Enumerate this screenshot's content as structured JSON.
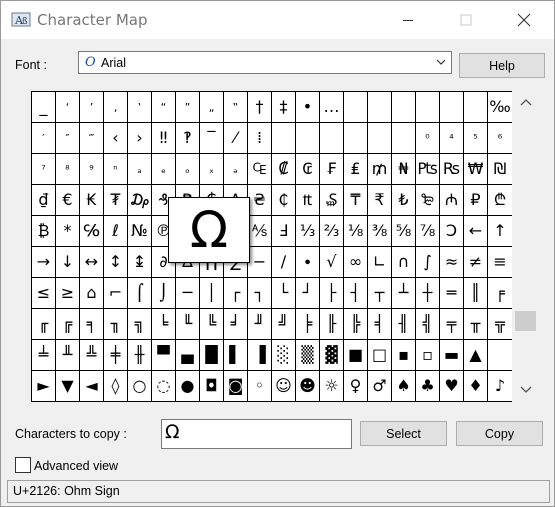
{
  "window": {
    "title": "Character Map"
  },
  "font": {
    "label": "Font :",
    "value": "Arial",
    "glyph": "O"
  },
  "buttons": {
    "help": "Help",
    "select": "Select",
    "copy": "Copy"
  },
  "grid": {
    "selected_row": 4,
    "selected_col": 7,
    "rows": [
      [
        "_",
        "‘",
        "’",
        "‚",
        "‛",
        "“",
        "”",
        "„",
        "‟",
        "†",
        "‡",
        "•",
        "…",
        "",
        "",
        "",
        "",
        "",
        "",
        "‰"
      ],
      [
        "′",
        "″",
        "‴",
        "‹",
        "›",
        "‼",
        "‽",
        "‾",
        "⁄",
        "⁞",
        "",
        "",
        "",
        "",
        "",
        "",
        "⁰",
        "⁴",
        "⁵",
        "⁶"
      ],
      [
        "⁷",
        "⁸",
        "⁹",
        "ⁿ",
        "ₐ",
        "ₑ",
        "ₒ",
        "ₓ",
        "ₔ",
        "₠",
        "₡",
        "₢",
        "₣",
        "₤",
        "₥",
        "₦",
        "₧",
        "₨",
        "₩",
        "₪"
      ],
      [
        "₫",
        "€",
        "₭",
        "₮",
        "₯",
        "₰",
        "₱",
        "₲",
        "₳",
        "₴",
        "₵",
        "₶",
        "₷",
        "₸",
        "₹",
        "₺",
        "₻",
        "₼",
        "₽",
        "₾"
      ],
      [
        "₿",
        "*",
        "℅",
        "ℓ",
        "№",
        "℗",
        "™",
        "Ω",
        "℮",
        "⅍",
        "Ⅎ",
        "⅓",
        "⅔",
        "⅛",
        "⅜",
        "⅝",
        "⅞",
        "Ↄ",
        "←",
        "↑"
      ],
      [
        "→",
        "↓",
        "↔",
        "↕",
        "↨",
        "∂",
        "∆",
        "∏",
        "∑",
        "−",
        "∕",
        "∙",
        "√",
        "∞",
        "∟",
        "∩",
        "∫",
        "≈",
        "≠",
        "≡"
      ],
      [
        "≤",
        "≥",
        "⌂",
        "⌐",
        "⌠",
        "⌡",
        "─",
        "│",
        "┌",
        "┐",
        "└",
        "┘",
        "├",
        "┤",
        "┬",
        "┴",
        "┼",
        "═",
        "║",
        "╒"
      ],
      [
        "╓",
        "╔",
        "╕",
        "╖",
        "╗",
        "╘",
        "╙",
        "╚",
        "╛",
        "╜",
        "╝",
        "╞",
        "╟",
        "╠",
        "╡",
        "╢",
        "╣",
        "╤",
        "╥",
        "╦"
      ],
      [
        "╧",
        "╨",
        "╩",
        "╪",
        "╫",
        "▀",
        "▄",
        "█",
        "▌",
        "▐",
        "░",
        "▒",
        "▓",
        "■",
        "□",
        "▪",
        "▫",
        "▬",
        "▲",
        ""
      ],
      [
        "►",
        "▼",
        "◄",
        "◊",
        "○",
        "◌",
        "●",
        "◘",
        "◙",
        "◦",
        "☺",
        "☻",
        "☼",
        "♀",
        "♂",
        "♠",
        "♣",
        "♥",
        "♦",
        "♪"
      ]
    ]
  },
  "zoom": {
    "char": "Ω"
  },
  "copy": {
    "label": "Characters to copy :",
    "value": "Ω"
  },
  "advanced": {
    "label": "Advanced view",
    "checked": false
  },
  "status": {
    "text": "U+2126: Ohm Sign"
  },
  "icons": {
    "app": "character-map-icon",
    "minimize": "minimize-icon",
    "maximize": "maximize-icon",
    "close": "close-icon",
    "dropdown": "chevron-down-icon",
    "scroll_up": "chevron-up-icon",
    "scroll_down": "chevron-down-icon"
  }
}
